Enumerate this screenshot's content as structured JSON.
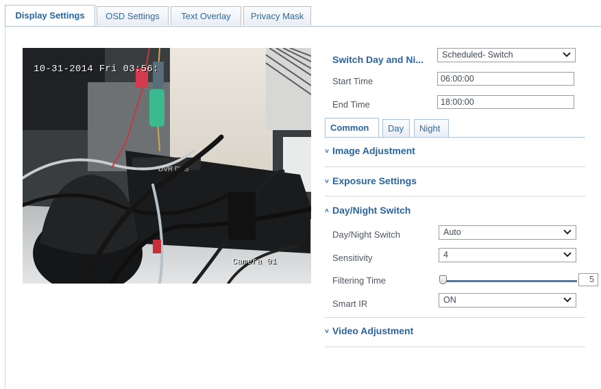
{
  "tabs": {
    "display": "Display Settings",
    "osd": "OSD Settings",
    "text_overlay": "Text Overlay",
    "privacy_mask": "Privacy Mask"
  },
  "video": {
    "osd_date": "10-31-2014 Fri 03:56:",
    "osd_camera": "Camera 01"
  },
  "switch_day_night": {
    "label": "Switch Day and Ni...",
    "value": "Scheduled- Switch",
    "start_label": "Start Time",
    "start_value": "06:00:00",
    "end_label": "End Time",
    "end_value": "18:00:00"
  },
  "subtabs": {
    "common": "Common",
    "day": "Day",
    "night": "Night"
  },
  "sections": {
    "image_adjustment": "Image Adjustment",
    "exposure_settings": "Exposure Settings",
    "day_night_switch": "Day/Night Switch",
    "video_adjustment": "Video Adjustment"
  },
  "day_night": {
    "switch_label": "Day/Night Switch",
    "switch_value": "Auto",
    "sensitivity_label": "Sensitivity",
    "sensitivity_value": "4",
    "filtering_label": "Filtering Time",
    "filtering_value": "5",
    "filtering_fraction": 0.0,
    "smart_ir_label": "Smart IR",
    "smart_ir_value": "ON"
  },
  "colors": {
    "accent": "#2a64a0",
    "tab_border": "#a9c0d8",
    "slider": "#3f79b0"
  }
}
